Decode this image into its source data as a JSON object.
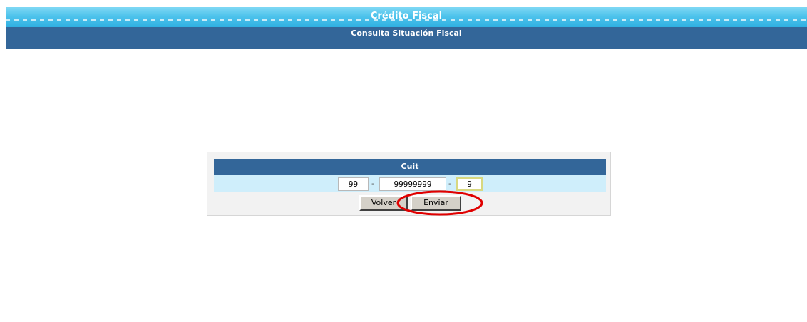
{
  "header": {
    "title": "Crédito Fiscal",
    "subtitle": "Consulta Situación Fiscal"
  },
  "form": {
    "label": "Cuit",
    "cuit_part1": "99",
    "cuit_part2": "99999999",
    "cuit_part3": "9",
    "separator": "-",
    "volver_label": "Volver",
    "enviar_label": "Enviar"
  },
  "colors": {
    "header_top": "#4ec3ec",
    "header_sub": "#336699",
    "panel_title": "#336699",
    "row_bg": "#cfeefb",
    "annotation": "#e00000"
  }
}
